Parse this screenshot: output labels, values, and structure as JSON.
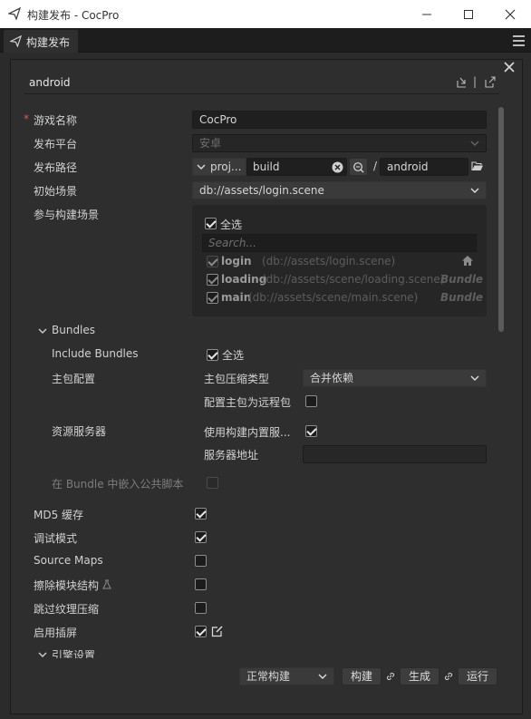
{
  "window": {
    "title": "构建发布 - CocPro"
  },
  "tab": {
    "label": "构建发布"
  },
  "header": {
    "platform_id": "android"
  },
  "form": {
    "game_name_label": "游戏名称",
    "game_name_value": "CocPro",
    "platform_label": "发布平台",
    "platform_value": "安卓",
    "path_label": "发布路径",
    "path_prefix": "proj...",
    "path_value": "build",
    "path_separator": "/",
    "path_suffix": "android",
    "start_scene_label": "初始场景",
    "start_scene_value": "db://assets/login.scene",
    "build_scenes_label": "参与构建场景"
  },
  "scenes": {
    "select_all_label": "全选",
    "search_placeholder": "Search...",
    "items": [
      {
        "name": "login",
        "path": "(db://assets/login.scene)",
        "tag": ""
      },
      {
        "name": "loading",
        "path": "(db://assets/scene/loading.scene)",
        "tag": "Bundle"
      },
      {
        "name": "main",
        "path": "(db://assets/scene/main.scene)",
        "tag": "Bundle"
      }
    ]
  },
  "bundles": {
    "section_label": "Bundles",
    "include_label": "Include Bundles",
    "include_select_all": "全选",
    "main_config_label": "主包配置",
    "compression_label": "主包压缩类型",
    "compression_value": "合并依赖",
    "remote_label": "配置主包为远程包",
    "server_label": "资源服务器",
    "builtin_server_label": "使用构建内置服...",
    "server_address_label": "服务器地址",
    "server_address_value": "",
    "embed_label": "在 Bundle 中嵌入公共脚本"
  },
  "options": {
    "md5_label": "MD5 缓存",
    "debug_label": "调试模式",
    "sourcemaps_label": "Source Maps",
    "erase_modules_label": "擦除模块结构",
    "skip_compress_label": "跳过纹理压缩",
    "splash_label": "启用插屏",
    "engine_settings_label": "引擎设置"
  },
  "footer": {
    "build_mode_value": "正常构建",
    "build_button": "构建",
    "make_button": "生成",
    "run_button": "运行"
  }
}
